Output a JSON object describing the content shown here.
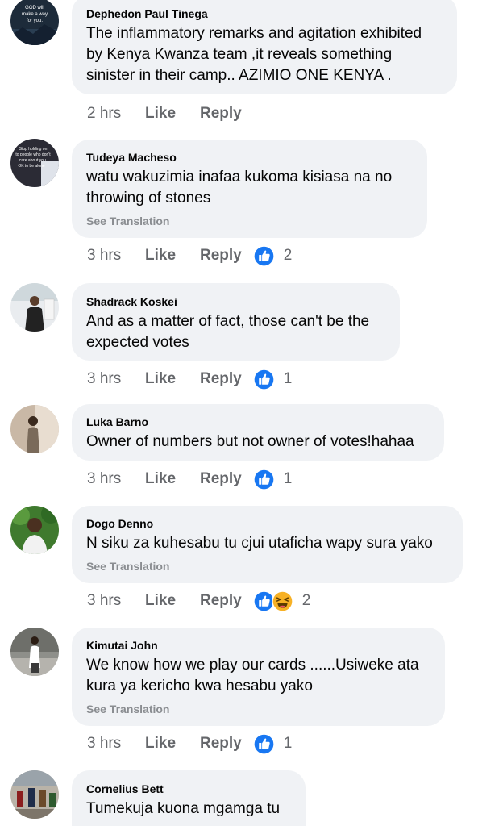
{
  "comments": [
    {
      "author": "Dephedon Paul Tinega",
      "text": "The inflammatory remarks and agitation exhibited by Kenya Kwanza team ,it reveals something sinister in their camp.. AZIMIO ONE KENYA  .",
      "see_translation": "",
      "time": "2 hrs",
      "like": "Like",
      "reply": "Reply",
      "reaction_count": "",
      "avatar_text": "GOD will make a way for you."
    },
    {
      "author": "Tudeya Macheso",
      "text": "watu wakuzimia  inafaa kukoma kisiasa na no throwing of stones",
      "see_translation": "See Translation",
      "time": "3 hrs",
      "like": "Like",
      "reply": "Reply",
      "reaction_count": "2",
      "avatar_text": "Stop holding on to people who don't care about you. OK to be alone"
    },
    {
      "author": "Shadrack Koskei",
      "text": "And as a matter of fact, those can't be the expected votes",
      "see_translation": "",
      "time": "3 hrs",
      "like": "Like",
      "reply": "Reply",
      "reaction_count": "1"
    },
    {
      "author": "Luka Barno",
      "text": "Owner of numbers but not owner of votes!hahaa",
      "see_translation": "",
      "time": "3 hrs",
      "like": "Like",
      "reply": "Reply",
      "reaction_count": "1"
    },
    {
      "author": "Dogo Denno",
      "text": "N siku za kuhesabu tu cjui utaficha wapy sura yako",
      "see_translation": "See Translation",
      "time": "3 hrs",
      "like": "Like",
      "reply": "Reply",
      "reaction_count": "2"
    },
    {
      "author": "Kimutai John",
      "text": "We know how we play our cards ......Usiweke ata kura ya kericho kwa hesabu yako",
      "see_translation": "See Translation",
      "time": "3 hrs",
      "like": "Like",
      "reply": "Reply",
      "reaction_count": "1"
    },
    {
      "author": "Cornelius Bett",
      "text": "Tumekuja kuona mgamga tu",
      "see_translation": "",
      "time": "",
      "like": "",
      "reply": "",
      "reaction_count": ""
    }
  ],
  "colors": {
    "bubble": "#f0f2f5",
    "meta_text": "#65676b",
    "like_blue": "#1877f2",
    "haha_yellow": "#f7b125"
  },
  "icons": {
    "like_reaction": "like-icon",
    "haha_reaction": "haha-icon"
  }
}
